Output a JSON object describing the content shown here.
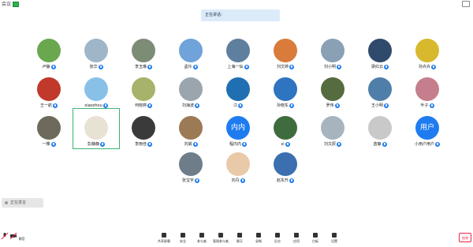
{
  "topbar": {
    "title": "会议"
  },
  "banner": {
    "text": "正在讲话："
  },
  "participants": [
    {
      "name": "卢静",
      "avatar": "#6aa84f",
      "text": ""
    },
    {
      "name": "张华",
      "avatar": "#9fb6c8",
      "text": ""
    },
    {
      "name": "李玉琳",
      "avatar": "#7c8c75",
      "text": ""
    },
    {
      "name": "孟玲",
      "avatar": "#6fa3d9",
      "text": ""
    },
    {
      "name": "上海一仙",
      "avatar": "#5f7f9f",
      "text": ""
    },
    {
      "name": "刘文婷",
      "avatar": "#d87b3b",
      "text": ""
    },
    {
      "name": "刘小明",
      "avatar": "#8aa0b4",
      "text": ""
    },
    {
      "name": "梁红云",
      "avatar": "#2f4a6b",
      "text": ""
    },
    {
      "name": "孙卉卉",
      "avatar": "#d8b92e",
      "text": ""
    },
    {
      "name": "王一航",
      "avatar": "#c0392b",
      "text": ""
    },
    {
      "name": "xiaozhou",
      "avatar": "#88c0e8",
      "text": ""
    },
    {
      "name": "何晓婷",
      "avatar": "#a7b36a",
      "text": ""
    },
    {
      "name": "刘海波",
      "avatar": "#9aa5ad",
      "text": ""
    },
    {
      "name": "江",
      "avatar": "#1f6fb2",
      "text": ""
    },
    {
      "name": "孙晓东",
      "avatar": "#2f74c0",
      "text": ""
    },
    {
      "name": "罗伟",
      "avatar": "#556b40",
      "text": ""
    },
    {
      "name": "王小明",
      "avatar": "#4f7fa8",
      "text": ""
    },
    {
      "name": "叶子",
      "avatar": "#c57e8c",
      "text": ""
    },
    {
      "name": "一棵",
      "avatar": "#6d6a5c",
      "text": ""
    },
    {
      "name": "彭静静",
      "avatar": "#e8e2d5",
      "text": ""
    },
    {
      "name": "李雨佳",
      "avatar": "#3a3a3a",
      "text": ""
    },
    {
      "name": "刘娟",
      "avatar": "#9b7a55",
      "text": ""
    },
    {
      "name": "程内内",
      "avatar": "#1f7cf0",
      "text": "内内"
    },
    {
      "name": "xi",
      "avatar": "#3f6c3f",
      "text": ""
    },
    {
      "name": "刘文辰",
      "avatar": "#a6b4c0",
      "text": ""
    },
    {
      "name": "苗静",
      "avatar": "#c9c9c9",
      "text": ""
    },
    {
      "name": "小用户用户",
      "avatar": "#1f7cf0",
      "text": "用户"
    },
    {
      "name": "张宝宇",
      "avatar": "#6f7d8a",
      "text": ""
    },
    {
      "name": "刘丹",
      "avatar": "#e8c9a8",
      "text": ""
    },
    {
      "name": "赵东升",
      "avatar": "#3b6fb0",
      "text": ""
    }
  ],
  "statusPill": {
    "label": "正在发言"
  },
  "bottombar": {
    "left": "静音",
    "items": [
      {
        "label": "共享屏幕",
        "icon": "share-screen-icon"
      },
      {
        "label": "安全",
        "icon": "shield-icon"
      },
      {
        "label": "参与者",
        "icon": "participants-icon"
      },
      {
        "label": "管理参与者",
        "icon": "manage-participants-icon"
      },
      {
        "label": "聊天",
        "icon": "chat-icon"
      },
      {
        "label": "录制",
        "icon": "record-icon"
      },
      {
        "label": "反应",
        "icon": "reaction-icon"
      },
      {
        "label": "应用",
        "icon": "apps-icon"
      },
      {
        "label": "白板",
        "icon": "whiteboard-icon"
      },
      {
        "label": "设置",
        "icon": "settings-icon"
      }
    ],
    "end": "结束"
  }
}
